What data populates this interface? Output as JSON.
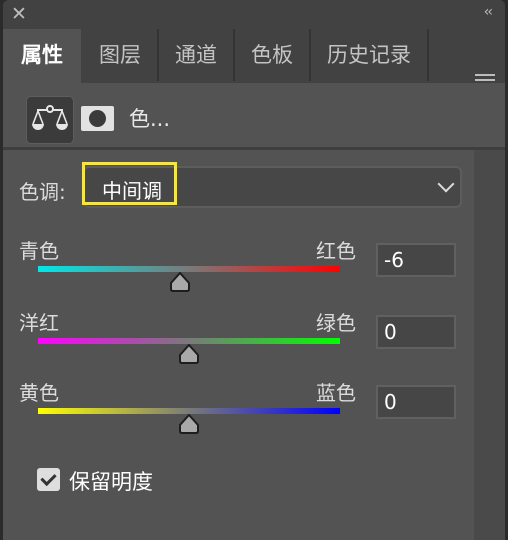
{
  "titlebar": {
    "close_icon": "✕",
    "collapse_icon": "‹‹"
  },
  "tabs": [
    {
      "label": "属性",
      "active": true
    },
    {
      "label": "图层",
      "active": false
    },
    {
      "label": "通道",
      "active": false
    },
    {
      "label": "色板",
      "active": false
    },
    {
      "label": "历史记录",
      "active": false
    }
  ],
  "panel_menu_icon": "hamburger-menu",
  "icon_row": {
    "adjustment_icon": "color-balance-scales-icon",
    "mask_icon": "layer-mask-icon",
    "label": "色..."
  },
  "tone": {
    "label": "色调:",
    "selected": "中间调",
    "highlight_color": "#f4e64a"
  },
  "sliders": [
    {
      "left_label": "青色",
      "right_label": "红色",
      "value": "-6",
      "min": -100,
      "max": 100,
      "colors": [
        "#00e8e8",
        "#ff0000"
      ]
    },
    {
      "left_label": "洋红",
      "right_label": "绿色",
      "value": "0",
      "min": -100,
      "max": 100,
      "colors": [
        "#ff00ff",
        "#00ff00"
      ]
    },
    {
      "left_label": "黄色",
      "right_label": "蓝色",
      "value": "0",
      "min": -100,
      "max": 100,
      "colors": [
        "#ffff00",
        "#0000ff"
      ]
    }
  ],
  "preserve_luminosity": {
    "label": "保留明度",
    "checked": true
  }
}
